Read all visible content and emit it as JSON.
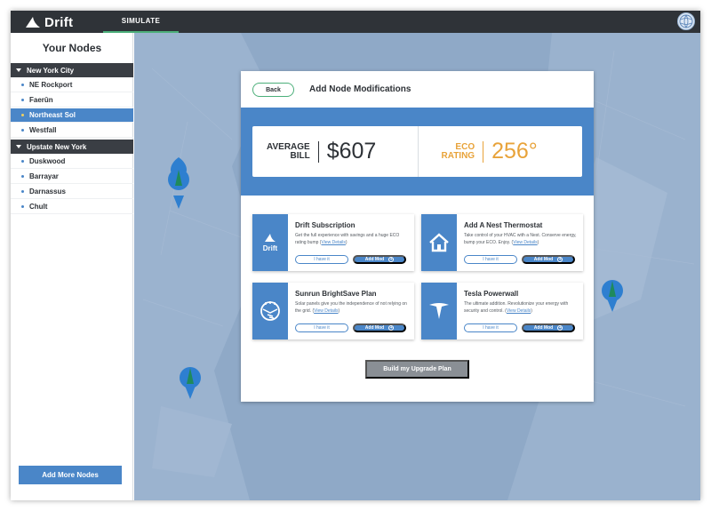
{
  "app": {
    "name": "Drift",
    "active_tab": "SIMULATE"
  },
  "sidebar": {
    "title": "Your Nodes",
    "groups": [
      {
        "name": "New York City",
        "nodes": [
          "NE Rockport",
          "Faerûn",
          "Northeast Sol",
          "Westfall"
        ]
      },
      {
        "name": "Upstate New York",
        "nodes": [
          "Duskwood",
          "Barrayar",
          "Darnassus",
          "Chult"
        ]
      }
    ],
    "selected_node": "Northeast Sol",
    "add_button": "Add More Nodes"
  },
  "modal": {
    "back_label": "Back",
    "title": "Add Node Modifications",
    "stats": {
      "avg_bill_label_1": "AVERAGE",
      "avg_bill_label_2": "BILL",
      "avg_bill_value": "$607",
      "eco_label_1": "ECO",
      "eco_label_2": "RATING",
      "eco_value": "256°"
    },
    "mods": [
      {
        "title": "Drift Subscription",
        "desc": "Get the full experience with savings and a huge ECO rating bump (",
        "link": "View Details",
        "desc_end": ")",
        "icon": "drift-logo-icon",
        "icon_text": "Drift",
        "have": "I have it",
        "add": "Add Mod"
      },
      {
        "title": "Add A Nest Thermostat",
        "desc": "Take control of your HVAC with a Nest. Conserve energy, bump your ECO. Enjoy. (",
        "link": "View Details",
        "desc_end": ")",
        "icon": "house-icon",
        "have": "I have it",
        "add": "Add Mod"
      },
      {
        "title": "Sunrun BrightSave Plan",
        "desc": "Solar panels give you the independence of not relying on the grid. (",
        "link": "View Details",
        "desc_end": ")",
        "icon": "solar-sun-icon",
        "have": "I have it",
        "add": "Add Mod"
      },
      {
        "title": "Tesla Powerwall",
        "desc": "The ultimate addition. Revolutionize your energy with security and control. (",
        "link": "View Details",
        "desc_end": ")",
        "icon": "tesla-logo-icon",
        "have": "I have it",
        "add": "Add Mod"
      }
    ],
    "build_button": "Build my Upgrade Plan"
  },
  "colors": {
    "primary_blue": "#4a86c8",
    "eco_orange": "#e8a33a",
    "topbar": "#2f3338",
    "accent_green": "#4caf7a"
  }
}
